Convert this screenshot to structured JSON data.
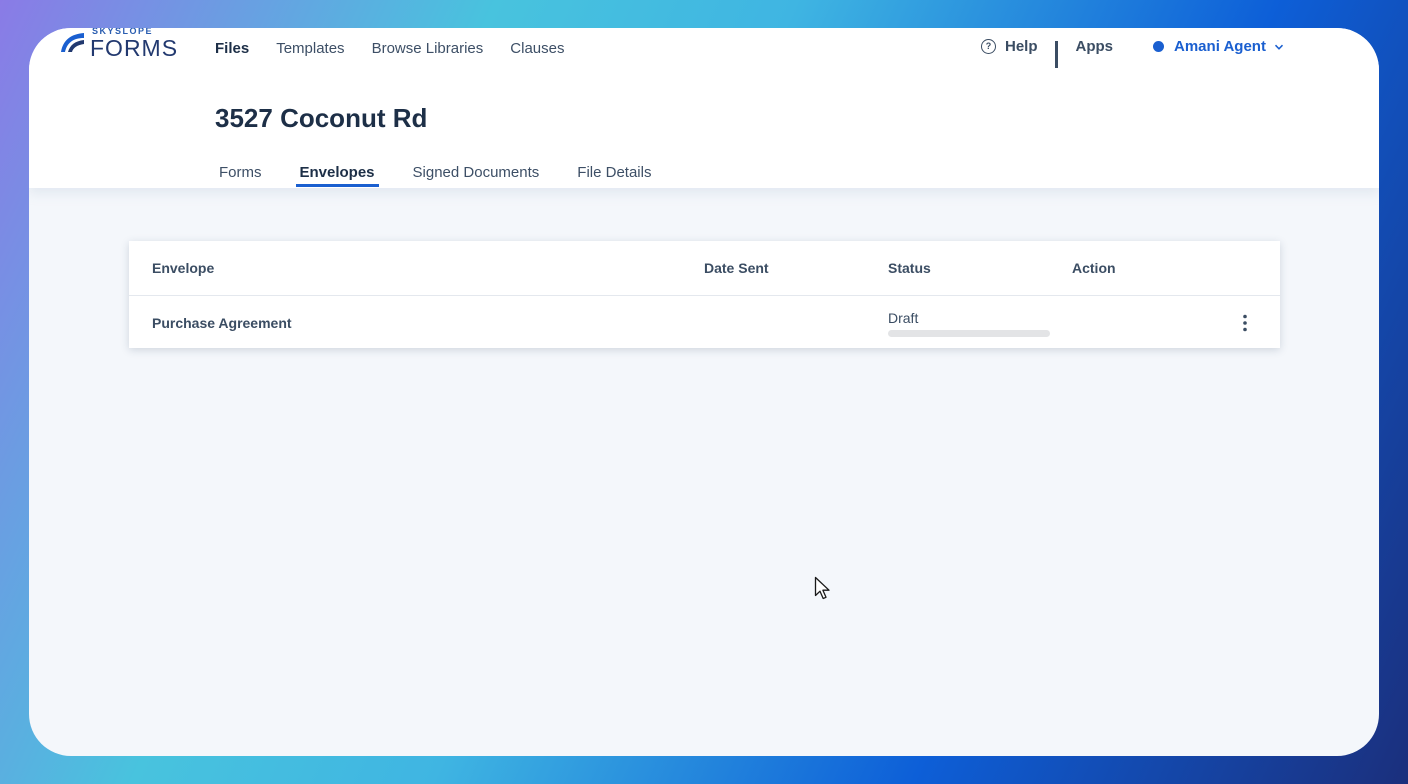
{
  "app": {
    "brand_small": "SKYSLOPE",
    "brand_big": "FORMS",
    "accent_color": "#1a5fd0"
  },
  "nav": {
    "items": [
      "Files",
      "Templates",
      "Browse Libraries",
      "Clauses"
    ],
    "active": "Files"
  },
  "header_right": {
    "help_label": "Help",
    "apps_label": "Apps",
    "user_name": "Amani Agent"
  },
  "page": {
    "title": "3527 Coconut Rd"
  },
  "tabs": {
    "items": [
      "Forms",
      "Envelopes",
      "Signed Documents",
      "File Details"
    ],
    "active": "Envelopes"
  },
  "table": {
    "headers": [
      "Envelope",
      "Date Sent",
      "Status",
      "Action"
    ],
    "rows": [
      {
        "envelope": "Purchase Agreement",
        "date_sent": "",
        "status": "Draft",
        "progress": 0
      }
    ]
  },
  "icons": {
    "help": "help-circle-icon",
    "apps": "grid-icon",
    "user_status": "dot-icon",
    "user_menu": "chevron-down-icon",
    "row_action": "kebab-icon",
    "pointer": "mouse-cursor-icon"
  }
}
